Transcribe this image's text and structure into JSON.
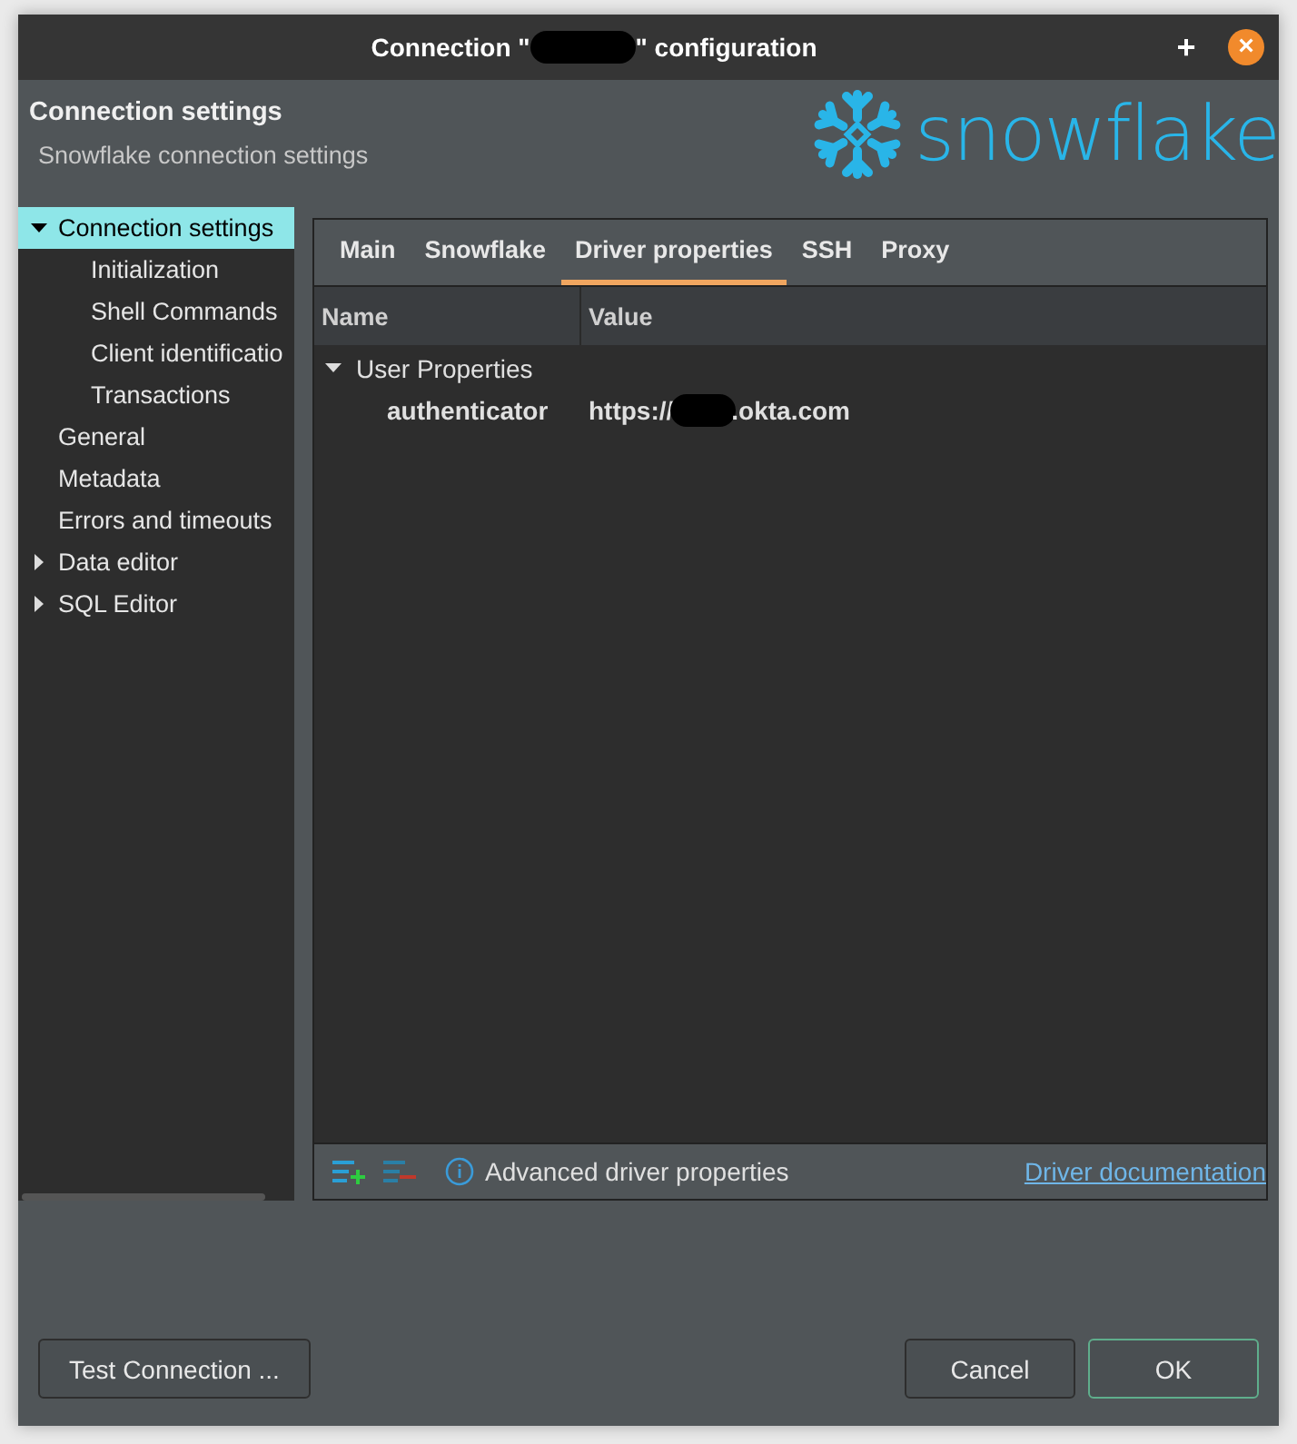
{
  "window": {
    "title_before": "Connection \"",
    "title_after": "\" configuration",
    "redacted": true,
    "buttons": [
      "+",
      "×"
    ]
  },
  "header": {
    "title": "Connection settings",
    "subtitle": "Snowflake connection settings",
    "logo_text": "snowflake"
  },
  "sidebar": {
    "items": [
      {
        "label": "Connection settings",
        "selected": true,
        "expanded": true,
        "children": [
          {
            "label": "Initialization",
            "selected": false
          },
          {
            "label": "Shell Commands",
            "selected": false
          },
          {
            "label": "Client identificatio",
            "selected": false
          },
          {
            "label": "Transactions",
            "selected": false
          }
        ]
      },
      {
        "label": "General",
        "selected": false
      },
      {
        "label": "Metadata",
        "selected": false
      },
      {
        "label": "Errors and timeouts",
        "selected": false
      },
      {
        "label": "Data editor",
        "selected": false,
        "expanded": false
      },
      {
        "label": "SQL Editor",
        "selected": false,
        "expanded": false
      }
    ]
  },
  "tabs": [
    {
      "label": "Main",
      "selected": false
    },
    {
      "label": "Snowflake",
      "selected": false
    },
    {
      "label": "Driver properties",
      "selected": true
    },
    {
      "label": "SSH",
      "selected": false
    },
    {
      "label": "Proxy",
      "selected": false
    }
  ],
  "table": {
    "columns": [
      "Name",
      "Value"
    ],
    "groups": [
      {
        "name": "User Properties",
        "expanded": true,
        "rows": [
          {
            "name": "authenticator",
            "value_before": "https://",
            "value_after": ".okta.com",
            "redacted": true
          }
        ]
      }
    ]
  },
  "footer": {
    "info": "Advanced driver properties",
    "link": "Driver documentation"
  },
  "buttons": {
    "test": "Test Connection ...",
    "cancel": "Cancel",
    "ok": "OK"
  }
}
